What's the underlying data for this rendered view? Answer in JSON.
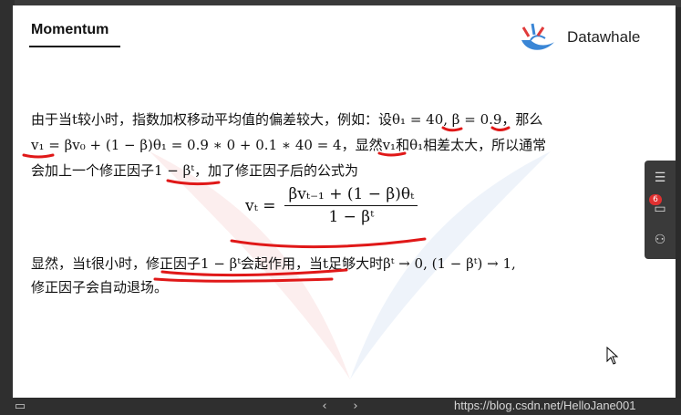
{
  "slide": {
    "title": "Momentum",
    "brand": "Datawhale",
    "line1": "由于当t较小时，指数加权移动平均值的偏差较大，例如：设θ₁ = 40, β = 0.9，那么",
    "line2": "v₁ = βv₀ + (1 − β)θ₁ = 0.9 ∗ 0 + 0.1 ∗ 40 = 4，显然v₁和θ₁相差太大，所以通常",
    "line3": "会加上一个修正因子1 − βᵗ，加了修正因子后的公式为",
    "formula_lhs": "vₜ =",
    "formula_num": "βvₜ₋₁ + (1 − β)θₜ",
    "formula_den": "1 − βᵗ",
    "line4": "显然，当t很小时，修正因子1 − βᵗ会起作用，当t足够大时βᵗ → 0, (1 − βᵗ) → 1,",
    "line5": "修正因子会自动退场。"
  },
  "side_panel": {
    "badge_count": "6"
  },
  "watermark": "https://blog.csdn.net/HelloJane001",
  "colors": {
    "ink": "#e01818",
    "panel": "#3a3a3a"
  }
}
